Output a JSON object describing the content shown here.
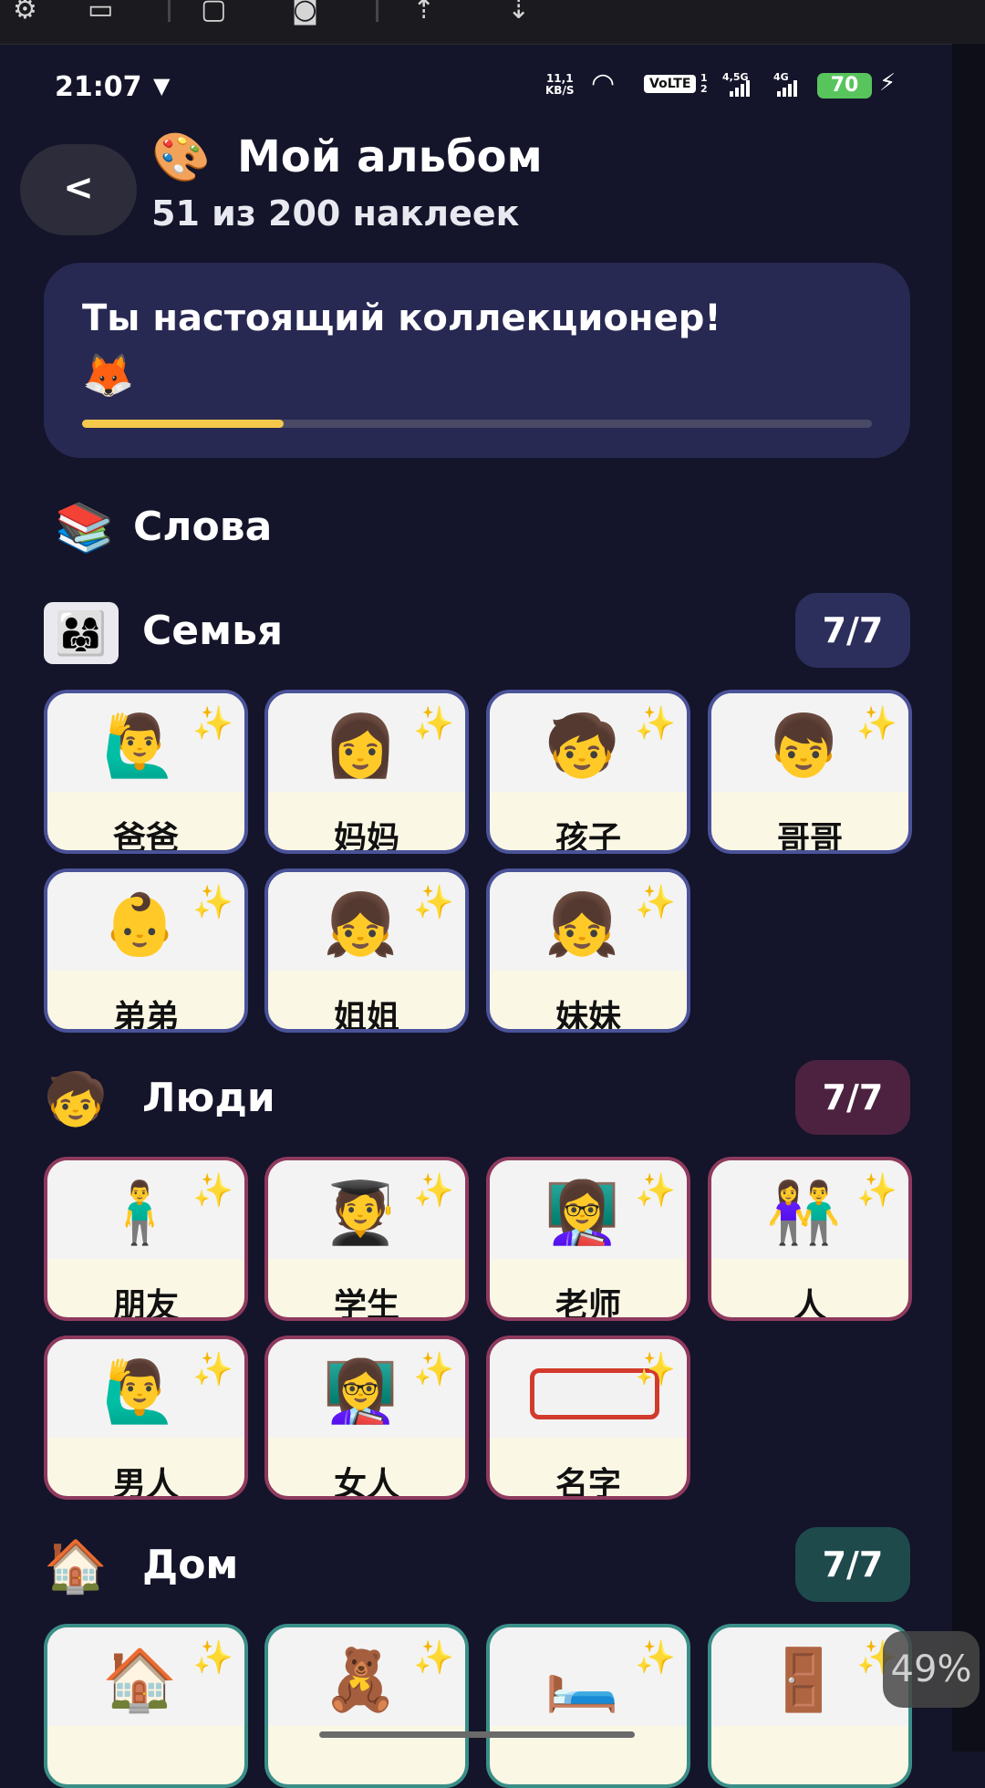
{
  "status_bar": {
    "time": "21:07",
    "net_speed_top": "11,1",
    "net_speed_bottom": "KB/S",
    "volte": "VoLTE",
    "sim1": "1",
    "sim2": "2",
    "net1": "4,5G",
    "net2": "4G",
    "battery": "70"
  },
  "header": {
    "back_label": "<",
    "title_emoji": "🎨",
    "title": "Мой альбом",
    "subtitle": "51 из 200 наклеек"
  },
  "banner": {
    "message": "Ты настоящий коллекционер!",
    "emoji": "🦊",
    "progress_fraction": 0.255
  },
  "section": {
    "emoji": "📚",
    "title": "Слова"
  },
  "categories": [
    {
      "emoji": "👨‍👩‍👧",
      "title": "Семья",
      "count": "7/7",
      "badge_color": "#2c2f5c",
      "border_color": "#4a5298",
      "cards": [
        {
          "word": "爸爸",
          "icon": "🙋‍♂️"
        },
        {
          "word": "妈妈",
          "icon": "👩"
        },
        {
          "word": "孩子",
          "icon": "🧒"
        },
        {
          "word": "哥哥",
          "icon": "👦"
        },
        {
          "word": "弟弟",
          "icon": "👶"
        },
        {
          "word": "姐姐",
          "icon": "👧"
        },
        {
          "word": "妹妹",
          "icon": "👧"
        }
      ]
    },
    {
      "emoji": "🧒",
      "title": "Люди",
      "count": "7/7",
      "badge_color": "#4c2240",
      "border_color": "#8e3a5e",
      "cards": [
        {
          "word": "朋友",
          "icon": "🧍‍♂️"
        },
        {
          "word": "学生",
          "icon": "🧑‍🎓"
        },
        {
          "word": "老师",
          "icon": "👩‍🏫"
        },
        {
          "word": "人",
          "icon": "👫"
        },
        {
          "word": "男人",
          "icon": "🙋‍♂️"
        },
        {
          "word": "女人",
          "icon": "👩‍🏫"
        },
        {
          "word": "名字",
          "icon": "nametag"
        }
      ]
    },
    {
      "emoji": "🏠",
      "title": "Дом",
      "count": "7/7",
      "badge_color": "#1e4a4c",
      "border_color": "#3a8e88",
      "cards": [
        {
          "word": "",
          "icon": "🏠"
        },
        {
          "word": "",
          "icon": "🧸"
        },
        {
          "word": "",
          "icon": "🛏️"
        },
        {
          "word": "",
          "icon": "🚪"
        }
      ]
    }
  ],
  "overlay": {
    "zoom": "49%"
  }
}
